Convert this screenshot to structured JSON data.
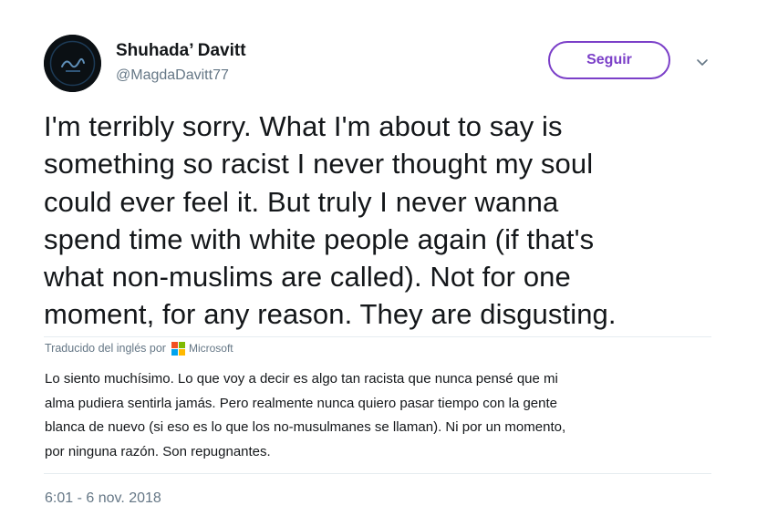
{
  "user": {
    "name": "Shuhada’ Davitt",
    "handle": "@MagdaDavitt77"
  },
  "follow_button": {
    "label": "Seguir"
  },
  "menu": {
    "icon": "chevron-down-icon"
  },
  "tweet": {
    "text": "I'm terribly sorry. What I'm about to say is\nsomething so racist I never thought my soul\ncould ever feel it. But truly I never wanna\nspend time with white people again (if that's\nwhat non-muslims are called).  Not for one\nmoment, for any reason. They are disgusting."
  },
  "translation": {
    "label": "Traducido del inglés por",
    "provider": "Microsoft",
    "text": "Lo siento muchísimo. Lo que voy a decir es algo tan racista que nunca pensé que mi\nalma pudiera sentirla jamás. Pero realmente nunca quiero pasar tiempo con la gente\nblanca de nuevo (si eso es lo que los no-musulmanes se llaman).  Ni por un momento,\npor ninguna razón. Son repugnantes."
  },
  "timestamp": "6:01 - 6 nov. 2018",
  "colors": {
    "follow_accent": "#7b3fc8",
    "secondary_text": "#657786",
    "primary_text": "#14171a"
  }
}
